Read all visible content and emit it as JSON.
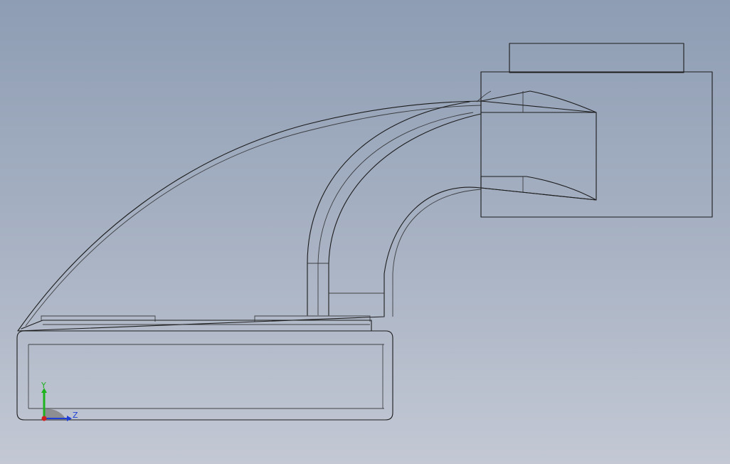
{
  "viewport": {
    "background_top": "#8e9db4",
    "background_bottom": "#c3c8d4"
  },
  "model": {
    "body_color": "#575553",
    "highlight_color": "#6a6866",
    "edge_color": "#1c1c1c"
  },
  "triad": {
    "y_label": "Y",
    "z_label": "Z",
    "y_color": "#1db31d",
    "z_color": "#1f3fd6",
    "x_color": "#d01f1f"
  }
}
